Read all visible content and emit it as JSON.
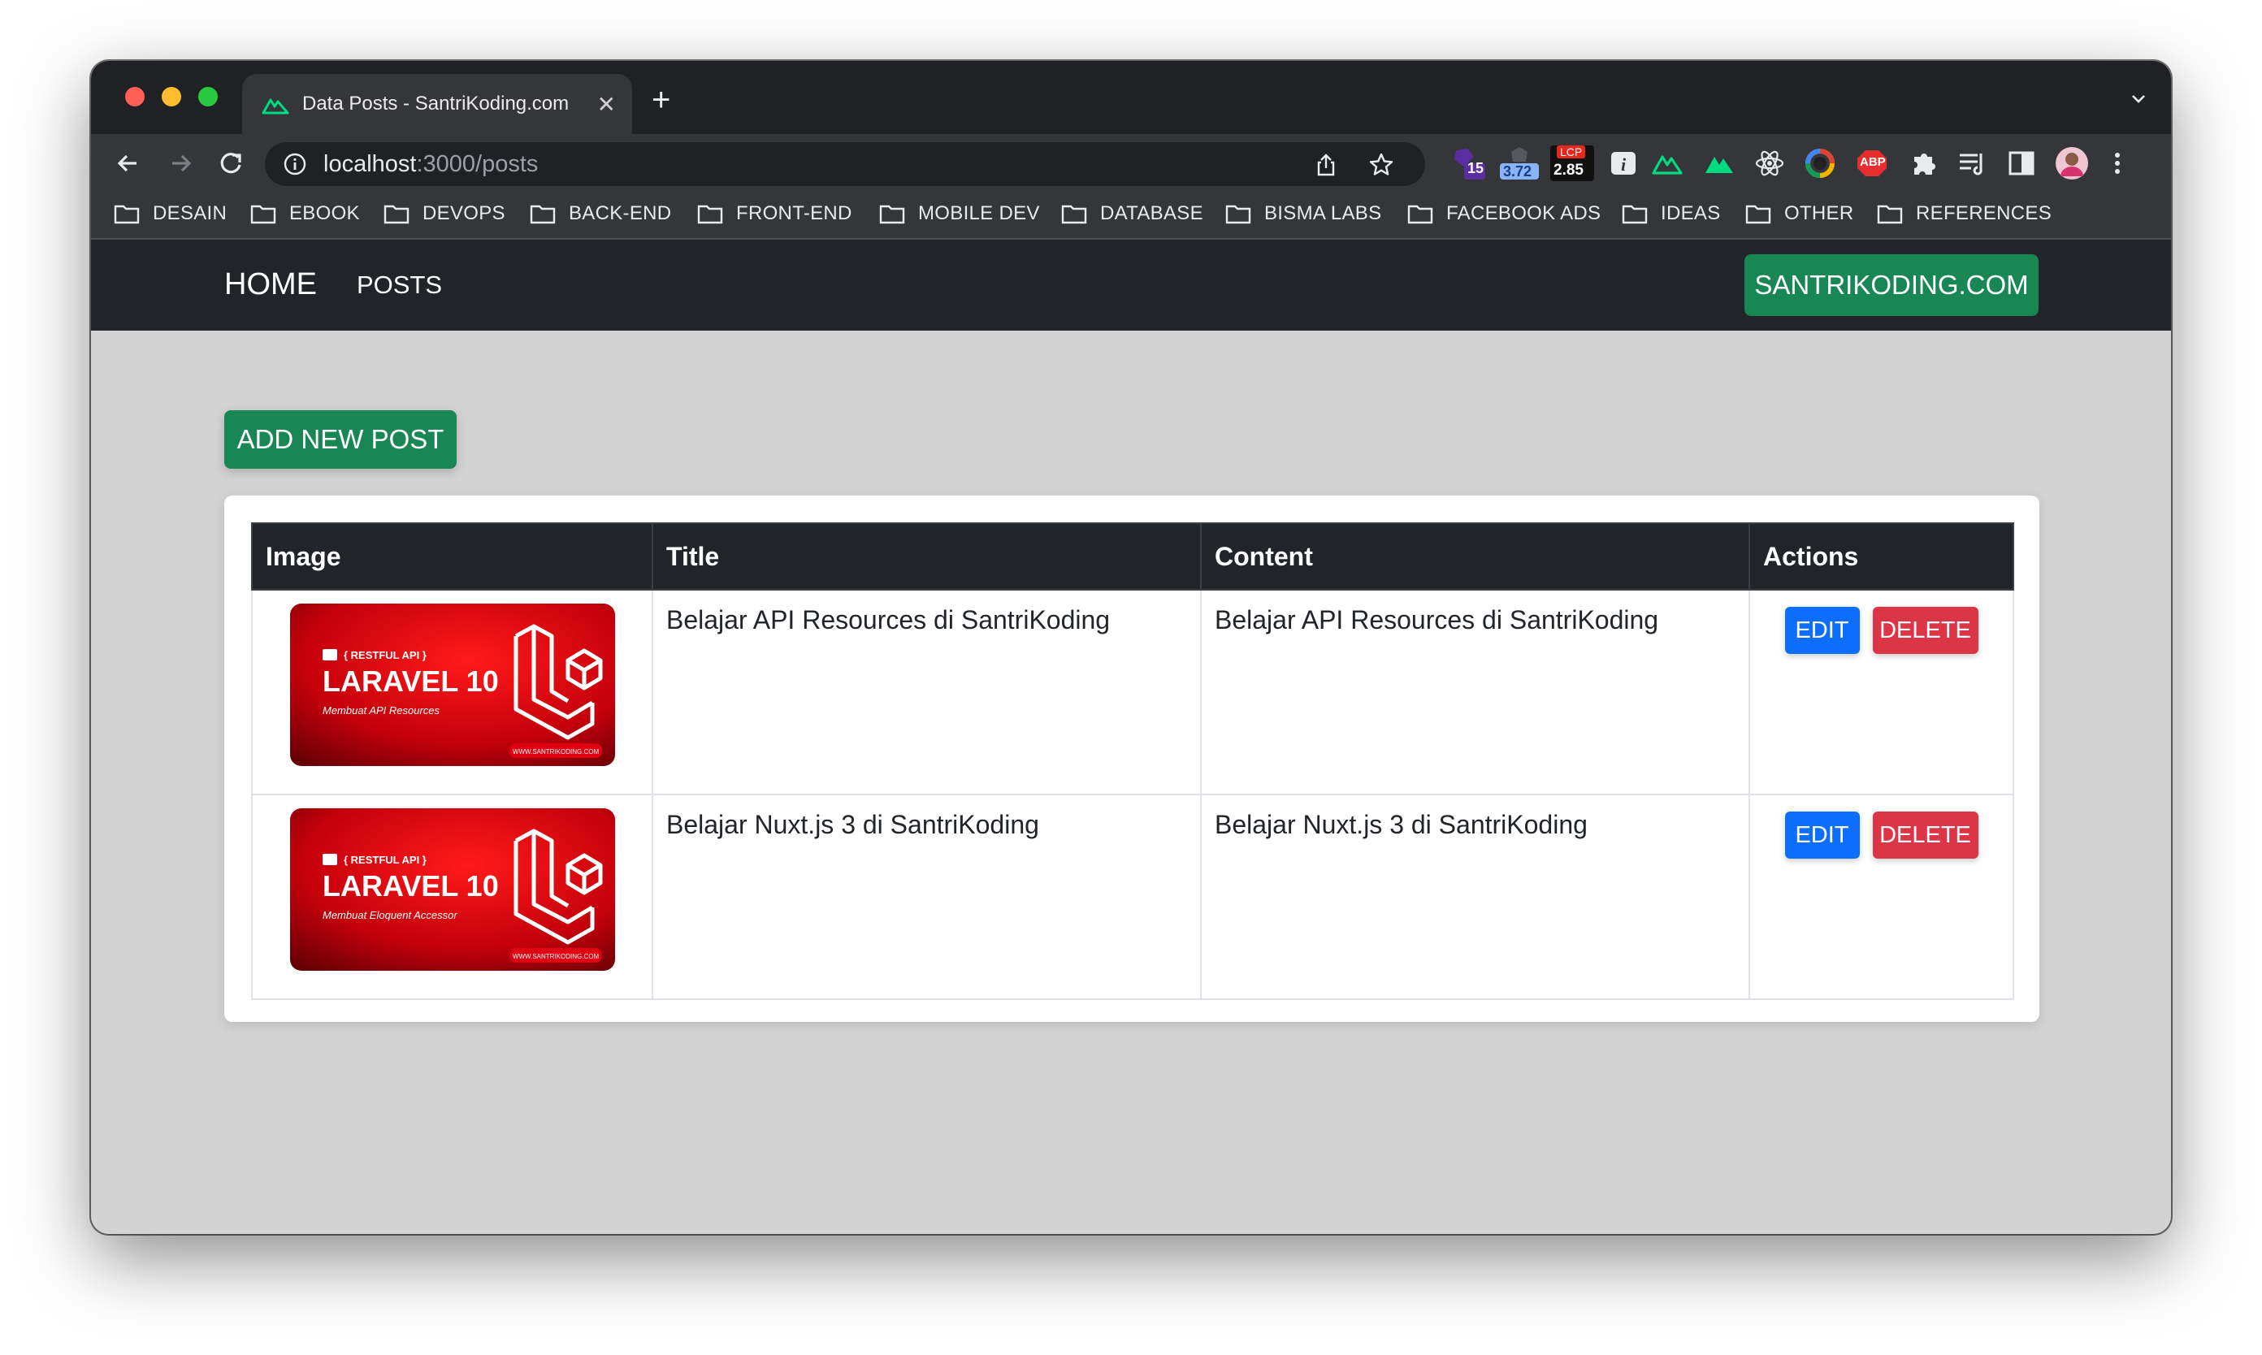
{
  "browser": {
    "tab_title": "Data Posts - SantriKoding.com",
    "tab_close": "✕",
    "new_tab": "+",
    "url_host": "localhost",
    "url_path": ":3000/posts",
    "extensions": {
      "badge_1": "15",
      "badge_2": "3.72",
      "lcp_label": "LCP",
      "lcp_value": "2.85",
      "abp": "ABP"
    },
    "bookmarks": [
      "DESAIN",
      "EBOOK",
      "DEVOPS",
      "BACK-END",
      "FRONT-END",
      "MOBILE DEV",
      "DATABASE",
      "BISMA LABS",
      "FACEBOOK ADS",
      "IDEAS",
      "OTHER",
      "REFERENCES"
    ]
  },
  "navbar": {
    "home": "HOME",
    "posts": "POSTS",
    "brand_button": "SANTRIKODING.COM"
  },
  "main": {
    "add_button": "ADD NEW POST",
    "table": {
      "headers": [
        "Image",
        "Title",
        "Content",
        "Actions"
      ],
      "rows": [
        {
          "image": {
            "tag": "{ RESTFUL API }",
            "heading": "LARAVEL 10",
            "subtitle": "Membuat API Resources",
            "site": "WWW.SANTRIKODING.COM"
          },
          "title": "Belajar API Resources di SantriKoding",
          "content": "Belajar API Resources di SantriKoding",
          "edit": "EDIT",
          "delete": "DELETE"
        },
        {
          "image": {
            "tag": "{ RESTFUL API }",
            "heading": "LARAVEL 10",
            "subtitle": "Membuat Eloquent Accessor",
            "site": "WWW.SANTRIKODING.COM"
          },
          "title": "Belajar Nuxt.js 3 di SantriKoding",
          "content": "Belajar Nuxt.js 3 di SantriKoding",
          "edit": "EDIT",
          "delete": "DELETE"
        }
      ]
    }
  },
  "colors": {
    "success": "#198754",
    "primary": "#0d6efd",
    "danger": "#dc3545",
    "dark": "#212529",
    "page_bg": "#d3d3d3",
    "thumb_red": "#d4000f"
  }
}
